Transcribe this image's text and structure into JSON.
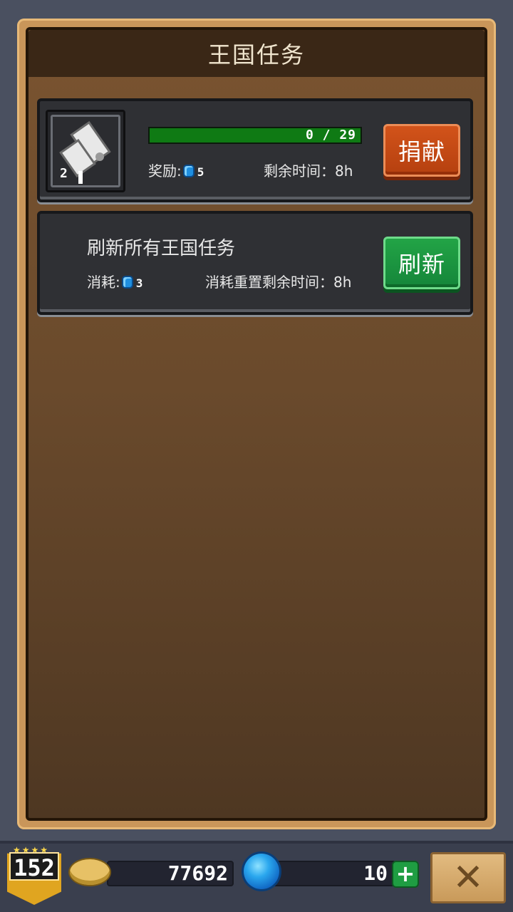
{
  "panel": {
    "title": "王国任务"
  },
  "task": {
    "item_count": "2",
    "item_icon": "scroll-icon",
    "progress_text": "0 / 29",
    "progress_fraction": 0.0,
    "reward_label": "奖励:",
    "reward_amount": "5",
    "time_label": "剩余时间：8h",
    "donate_label": "捐献"
  },
  "refresh": {
    "title": "刷新所有王国任务",
    "cost_label": "消耗:",
    "cost_amount": "3",
    "reset_label": "消耗重置剩余时间：8h",
    "refresh_label": "刷新"
  },
  "hud": {
    "level": "152",
    "coins": "77692",
    "gems": "10",
    "plus_label": "+",
    "close_label": "✕"
  },
  "colors": {
    "progress_fill": "#0f7a14",
    "donate_button": "#c24a14",
    "refresh_button": "#1a9640"
  }
}
